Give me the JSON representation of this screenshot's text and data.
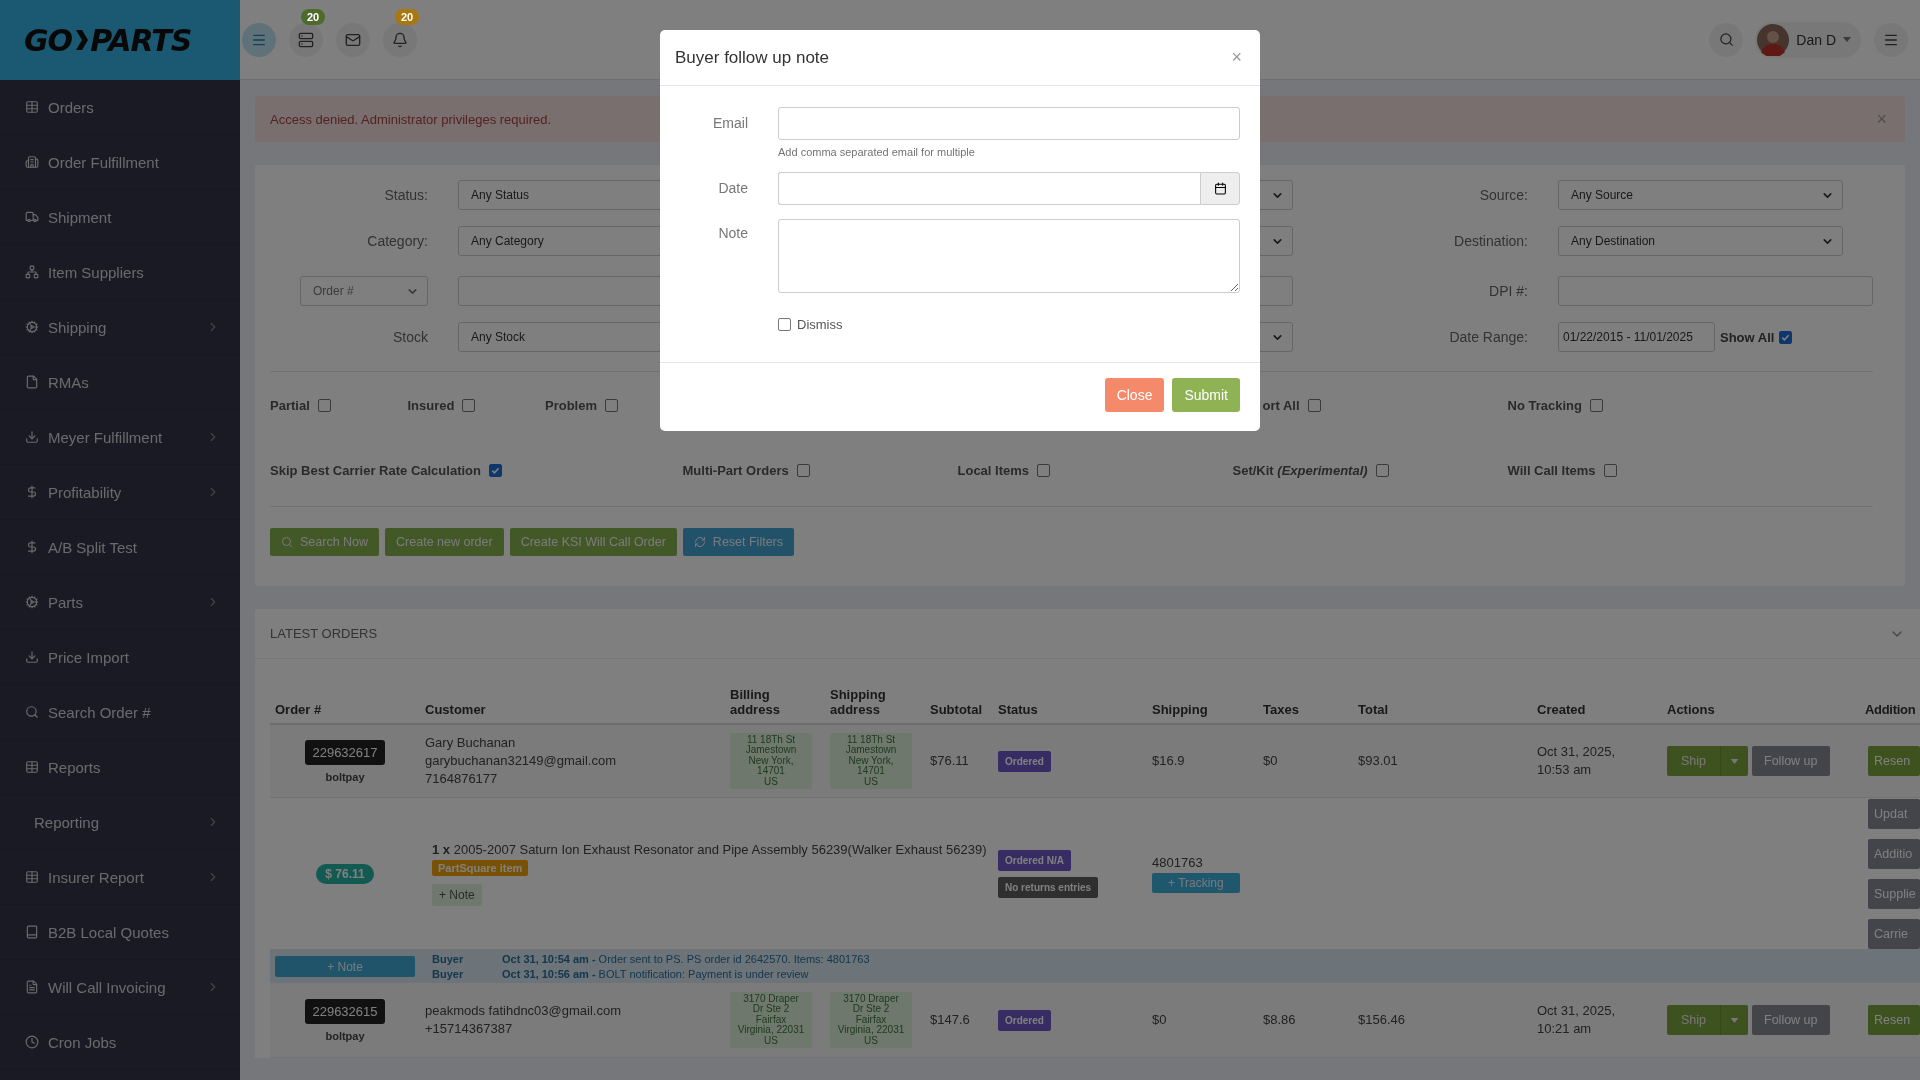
{
  "sidebar": {
    "logo": [
      "GO",
      "PARTS"
    ],
    "items": [
      {
        "label": "Orders",
        "has_submenu": false
      },
      {
        "label": "Order Fulfillment",
        "has_submenu": false
      },
      {
        "label": "Shipment",
        "has_submenu": false
      },
      {
        "label": "Item Suppliers",
        "has_submenu": false
      },
      {
        "label": "Shipping",
        "has_submenu": true
      },
      {
        "label": "RMAs",
        "has_submenu": false
      },
      {
        "label": "Meyer Fulfillment",
        "has_submenu": true
      },
      {
        "label": "Profitability",
        "has_submenu": true
      },
      {
        "label": "A/B Split Test",
        "has_submenu": false
      },
      {
        "label": "Parts",
        "has_submenu": true
      },
      {
        "label": "Price Import",
        "has_submenu": false
      },
      {
        "label": "Search Order #",
        "has_submenu": false
      },
      {
        "label": "Reports",
        "has_submenu": false
      },
      {
        "label": "Reporting",
        "has_submenu": true
      },
      {
        "label": "Insurer Report",
        "has_submenu": true
      },
      {
        "label": "B2B Local Quotes",
        "has_submenu": false
      },
      {
        "label": "Will Call Invoicing",
        "has_submenu": true
      },
      {
        "label": "Cron Jobs",
        "has_submenu": false
      }
    ]
  },
  "topbar": {
    "badges": [
      {
        "count": "20",
        "color": "#4f6b2c"
      },
      {
        "count": "20",
        "color": "#a8780f"
      }
    ],
    "user": "Dan D"
  },
  "alert": {
    "message": "Access denied. Administrator privileges required.",
    "close": "×"
  },
  "filters": {
    "rows": [
      {
        "left": {
          "label": "Status:",
          "value": "Any Status",
          "kind": "select"
        },
        "right": {
          "label": "Source:",
          "value": "Any Source",
          "kind": "select"
        }
      },
      {
        "left": {
          "label": "Category:",
          "value": "Any Category",
          "kind": "select"
        },
        "right": {
          "label": "Destination:",
          "value": "Any Destination",
          "kind": "select"
        }
      },
      {
        "left": {
          "selector": "Order #",
          "kind": "input"
        },
        "right": {
          "label": "DPI #:",
          "kind": "input"
        }
      },
      {
        "left": {
          "label": "Stock",
          "value": "Any Stock",
          "kind": "select"
        },
        "right": {
          "label": "Date Range:",
          "value": "01/22/2015 - 11/01/2025",
          "kind": "date",
          "extra_label": "Show All",
          "extra_checked": true
        }
      }
    ],
    "options": [
      {
        "label": "Partial",
        "checked": false
      },
      {
        "label": "Insured",
        "checked": false
      },
      {
        "label": "Problem",
        "checked": false
      },
      {
        "label": "ort All",
        "checked": false
      },
      {
        "label": "No Tracking",
        "checked": false
      },
      {
        "label": "Skip Best Carrier Rate Calculation",
        "checked": true
      },
      {
        "label": "Multi-Part Orders",
        "checked": false
      },
      {
        "label": "Local Items",
        "checked": false
      },
      {
        "label": "Set/Kit *(Experimental)*",
        "checked": false
      },
      {
        "label": "Will Call Items",
        "checked": false
      }
    ],
    "buttons": [
      {
        "label": "Search Now",
        "kind": "search"
      },
      {
        "label": "Create new order",
        "kind": "primary"
      },
      {
        "label": "Create KSI Will Call Order",
        "kind": "primary"
      },
      {
        "label": "Reset Filters",
        "kind": "reset"
      }
    ]
  },
  "latest_orders": {
    "title": "LATEST ORDERS",
    "columns": [
      "Order #",
      "Customer",
      "Billing address",
      "Shipping address",
      "Subtotal",
      "Status",
      "Shipping",
      "Taxes",
      "Total",
      "Created",
      "Actions",
      "Addition"
    ],
    "orders": [
      {
        "number": "229632617",
        "payment": "boltpay",
        "customer": [
          "Gary Buchanan",
          "garybuchanan32149@gmail.com",
          "7164876177"
        ],
        "billing": [
          "11 18Th St",
          "Jamestown",
          "New York,",
          "14701",
          "US"
        ],
        "shipping": [
          "11 18Th St",
          "Jamestown",
          "New York,",
          "14701",
          "US"
        ],
        "subtotal": "$76.11",
        "status": "Ordered",
        "shipping_cost": "$16.9",
        "taxes": "$0",
        "total": "$93.01",
        "created": [
          "Oct 31, 2025,",
          "10:53 am"
        ],
        "ship": "Ship",
        "follow_up": "Follow up",
        "extra": "Resen",
        "detail": {
          "amount": "$ 76.11",
          "item": "**1 x** 2005-2007 Saturn Ion Exhaust Resonator and Pipe Assembly 56239(Walker Exhaust 56239)",
          "tag": "PartSquare item",
          "note_button": "+ Note",
          "statuses": [
            {
              "label": "Ordered N/A",
              "kind": "ordered"
            },
            {
              "label": "No returns entries",
              "kind": "muted"
            }
          ],
          "tracking_number": "4801763",
          "tracking_button": "+ Tracking",
          "side_buttons": [
            "Updat",
            "Additio",
            "Supplie",
            "Carrie"
          ]
        },
        "notes": {
          "button": "+ Note",
          "entries": [
            {
              "author": "Buyer",
              "text": "**Oct 31, 10:54 am -** Order sent to PS. PS order id 2642570. Items: 4801763"
            },
            {
              "author": "Buyer",
              "text": "**Oct 31, 10:56 am -** BOLT notification: Payment is under review"
            }
          ]
        }
      },
      {
        "number": "229632615",
        "payment": "boltpay",
        "customer": [
          "peakmods fatihdnc03@gmail.com",
          "+15714367387"
        ],
        "billing": [
          "3170 Draper",
          "Dr Ste 2",
          "Fairfax",
          "Virginia, 22031",
          "US"
        ],
        "shipping": [
          "3170 Draper",
          "Dr Ste 2",
          "Fairfax",
          "Virginia, 22031",
          "US"
        ],
        "subtotal": "$147.6",
        "status": "Ordered",
        "shipping_cost": "$0",
        "taxes": "$8.86",
        "total": "$156.46",
        "created": [
          "Oct 31, 2025,",
          "10:21 am"
        ],
        "ship": "Ship",
        "follow_up": "Follow up",
        "extra": "Resen"
      }
    ]
  },
  "modal": {
    "title": "Buyer follow up note",
    "close": "×",
    "fields": [
      {
        "label": "Email",
        "kind": "text",
        "help": "Add comma separated email for multiple"
      },
      {
        "label": "Date",
        "kind": "date"
      },
      {
        "label": "Note",
        "kind": "textarea"
      }
    ],
    "dismiss": {
      "label": "Dismiss",
      "checked": false
    },
    "buttons": [
      {
        "label": "Close",
        "kind": "cancel"
      },
      {
        "label": "Submit",
        "kind": "submit"
      }
    ]
  }
}
